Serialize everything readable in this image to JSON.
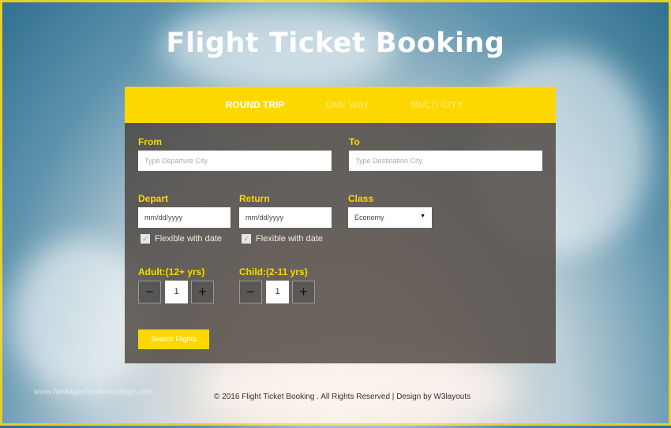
{
  "title": "Flight Ticket Booking",
  "tabs": [
    {
      "label": "ROUND TRIP",
      "active": true
    },
    {
      "label": "ONE WAY"
    },
    {
      "label": "MULTI CITY"
    }
  ],
  "form": {
    "from_label": "From",
    "from_placeholder": "Type Departure City",
    "to_label": "To",
    "to_placeholder": "Type Destination City",
    "depart_label": "Depart",
    "depart_value": "mm/dd/yyyy",
    "return_label": "Return",
    "return_value": "mm/dd/yyyy",
    "class_label": "Class",
    "class_value": "Economy",
    "flexible_label": "Flexible with date",
    "adult_label": "Adult:(12+ yrs)",
    "adult_value": "1",
    "child_label": "Child:(2-11 yrs)",
    "child_value": "1",
    "minus": "−",
    "plus": "+",
    "search_label": "Search Flights"
  },
  "footer": "© 2016 Flight Ticket Booking . All Rights Reserved | Design by W3layouts",
  "watermark": "www.heritagechristiancollege.com",
  "colors": {
    "accent": "#fcd800"
  }
}
